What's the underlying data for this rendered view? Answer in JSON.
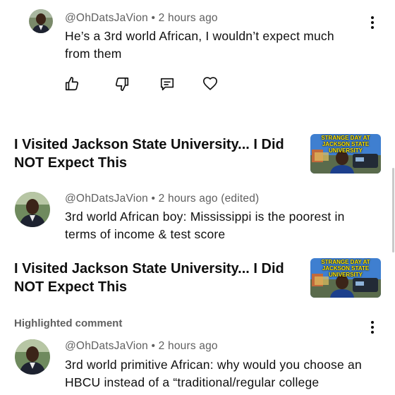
{
  "comments": [
    {
      "author": "@OhDatsJaVion",
      "time": "2 hours ago",
      "text": "He’s a 3rd world African, I wouldn’t expect much from them"
    },
    {
      "author": "@OhDatsJaVion",
      "time": "2 hours ago (edited)",
      "text": "3rd world African boy: Mississippi is the poorest in terms of income & test score"
    },
    {
      "author": "@OhDatsJaVion",
      "time": "2 hours ago",
      "text": "3rd world primitive African: why would you choose an HBCU instead of a “traditional/regular college"
    }
  ],
  "separator": "•",
  "videos": [
    {
      "title": "I Visited Jackson State University... I Did NOT Expect This",
      "thumbnail_text": "STRANGE DAY AT JACKSON STATE UNIVERSITY"
    },
    {
      "title": "I Visited Jackson State University... I Did NOT Expect This",
      "thumbnail_text": "STRANGE DAY AT JACKSON STATE UNIVERSITY"
    }
  ],
  "highlighted_label": "Highlighted comment",
  "icons": {
    "like": "thumbs-up-icon",
    "dislike": "thumbs-down-icon",
    "reply": "comment-icon",
    "heart": "heart-icon",
    "more": "more-vert-icon"
  },
  "colors": {
    "text": "#0f0f0f",
    "secondary_text": "#606060",
    "background": "#ffffff",
    "thumbnail_sky": "#3f7fd0",
    "thumbnail_text": "#ffe600"
  }
}
